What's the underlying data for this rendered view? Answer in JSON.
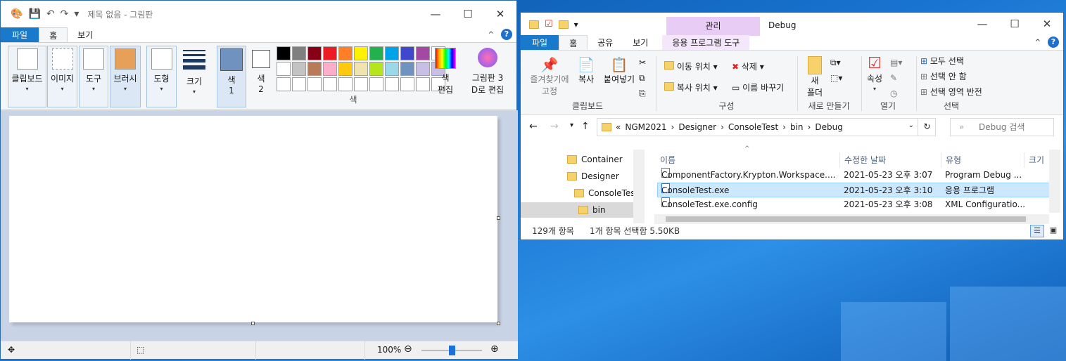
{
  "paint": {
    "title": "제목 없음 - 그림판",
    "tabs": [
      "파일",
      "홈",
      "보기"
    ],
    "tools": {
      "clipboard": "클립보드",
      "image": "이미지",
      "tools": "도구",
      "brushes": "브러시",
      "shapes": "도형",
      "size": "크기",
      "color1_a": "색",
      "color1_b": "1",
      "color2_a": "색",
      "color2_b": "2",
      "edit_colors_a": "색",
      "edit_colors_b": "편집",
      "paint3d_a": "그림판 3",
      "paint3d_b": "D로 편집",
      "colors_group": "색"
    },
    "palette": [
      "#000000",
      "#7f7f7f",
      "#880015",
      "#ed1c24",
      "#ff7f27",
      "#fff200",
      "#22b14c",
      "#00a2e8",
      "#3f48cc",
      "#a349a4",
      "#ffffff",
      "#c3c3c3",
      "#b97a57",
      "#ffaec9",
      "#ffc90e",
      "#efe4b0",
      "#b5e61d",
      "#99d9ea",
      "#7092be",
      "#c8bfe7"
    ],
    "color1": "#7092be",
    "zoom": "100%"
  },
  "explorer": {
    "title": "Debug",
    "context_header": "관리",
    "tabs": [
      "파일",
      "홈",
      "공유",
      "보기",
      "응용 프로그램 도구"
    ],
    "ribbon": {
      "pin": "즐겨찾기에 고정",
      "copy": "복사",
      "paste": "붙여넣기",
      "clipboard": "클립보드",
      "move_to": "이동 위치",
      "copy_to": "복사 위치",
      "delete": "삭제",
      "rename": "이름 바꾸기",
      "organize": "구성",
      "new_folder_a": "새",
      "new_folder_b": "폴더",
      "new": "새로 만들기",
      "properties": "속성",
      "open": "열기",
      "select_all": "모두 선택",
      "select_none": "선택 안 함",
      "invert": "선택 영역 반전",
      "select": "선택"
    },
    "breadcrumb": [
      "NGM2021",
      "Designer",
      "ConsoleTest",
      "bin",
      "Debug"
    ],
    "breadcrumb_prefix": "«",
    "search_placeholder": "Debug 검색",
    "tree": [
      "Container",
      "Designer",
      "ConsoleTest",
      "bin"
    ],
    "columns": {
      "name": "이름",
      "date": "수정한 날짜",
      "type": "유형",
      "size": "크기"
    },
    "files": [
      {
        "name": "ComponentFactory.Krypton.Workspace....",
        "date": "2021-05-23 오후 3:07",
        "type": "Program Debug ..."
      },
      {
        "name": "ConsoleTest.exe",
        "date": "2021-05-23 오후 3:10",
        "type": "응용 프로그램"
      },
      {
        "name": "ConsoleTest.exe.config",
        "date": "2021-05-23 오후 3:08",
        "type": "XML Configuratio..."
      }
    ],
    "status_items": "129개 항목",
    "status_selected": "1개 항목 선택함 5.50KB"
  }
}
